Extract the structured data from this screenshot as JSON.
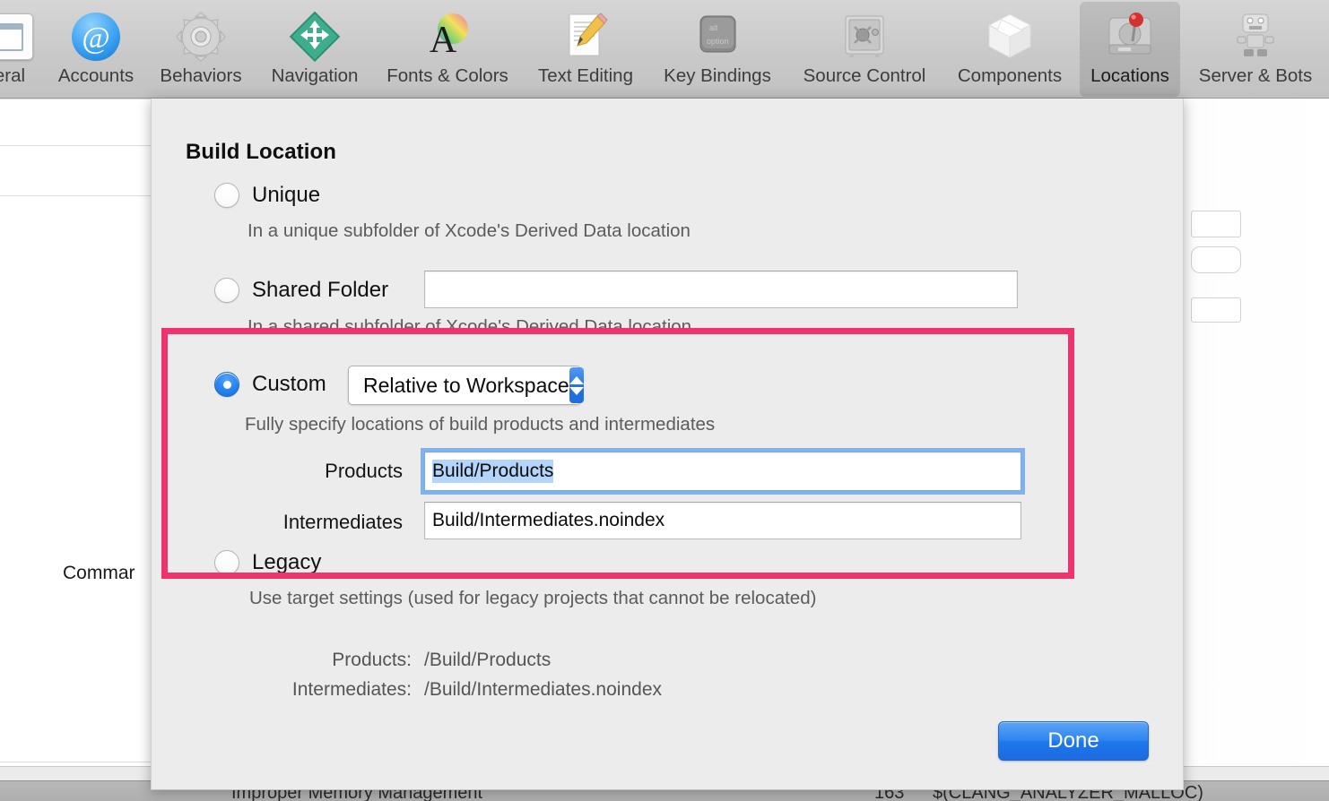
{
  "toolbar": {
    "items": [
      {
        "label": "eral",
        "icon": "general-icon",
        "selected": false
      },
      {
        "label": "Accounts",
        "icon": "accounts-at-sign-icon",
        "selected": false
      },
      {
        "label": "Behaviors",
        "icon": "gear-icon",
        "selected": false
      },
      {
        "label": "Navigation",
        "icon": "navigation-arrows-diamond-icon",
        "selected": false
      },
      {
        "label": "Fonts & Colors",
        "icon": "fonts-colors-icon",
        "selected": false
      },
      {
        "label": "Text Editing",
        "icon": "text-editing-pencil-icon",
        "selected": false
      },
      {
        "label": "Key Bindings",
        "icon": "key-bindings-option-key-icon",
        "selected": false
      },
      {
        "label": "Source Control",
        "icon": "source-control-safe-icon",
        "selected": false
      },
      {
        "label": "Components",
        "icon": "components-box-icon",
        "selected": false
      },
      {
        "label": "Locations",
        "icon": "locations-hard-drive-pin-icon",
        "selected": true
      },
      {
        "label": "Server & Bots",
        "icon": "server-bots-robot-icon",
        "selected": false
      }
    ]
  },
  "background": {
    "command_label": "Commar",
    "bottom_left_text": "Improper Memory Management",
    "bottom_right_number": "163",
    "bottom_right_text": "$(CLANG_ANALYZER_MALLOC)"
  },
  "sheet": {
    "section_title": "Build Location",
    "options": [
      {
        "id": "unique",
        "label": "Unique",
        "selected": false,
        "description": "In a unique subfolder of Xcode's Derived Data location"
      },
      {
        "id": "shared-folder",
        "label": "Shared Folder",
        "selected": false,
        "description": "In a shared subfolder of Xcode's Derived Data location",
        "field_value": "",
        "field_placeholder": ""
      },
      {
        "id": "custom",
        "label": "Custom",
        "selected": true,
        "description": "Fully specify locations of build products and intermediates",
        "dropdown_value": "Relative to Workspace"
      },
      {
        "id": "legacy",
        "label": "Legacy",
        "selected": false,
        "description": "Use target settings (used for legacy projects that cannot be relocated)"
      }
    ],
    "custom_fields": [
      {
        "label": "Products",
        "value": "Build/Products",
        "focused": true,
        "selected_text": true
      },
      {
        "label": "Intermediates",
        "value": "Build/Intermediates.noindex",
        "focused": false,
        "selected_text": false
      }
    ],
    "summary": [
      {
        "label": "Products:",
        "value": "/Build/Products"
      },
      {
        "label": "Intermediates:",
        "value": "/Build/Intermediates.noindex"
      }
    ],
    "done_label": "Done"
  },
  "annotation": {
    "color": "#f0336c",
    "shape": "rectangle-highlight"
  }
}
